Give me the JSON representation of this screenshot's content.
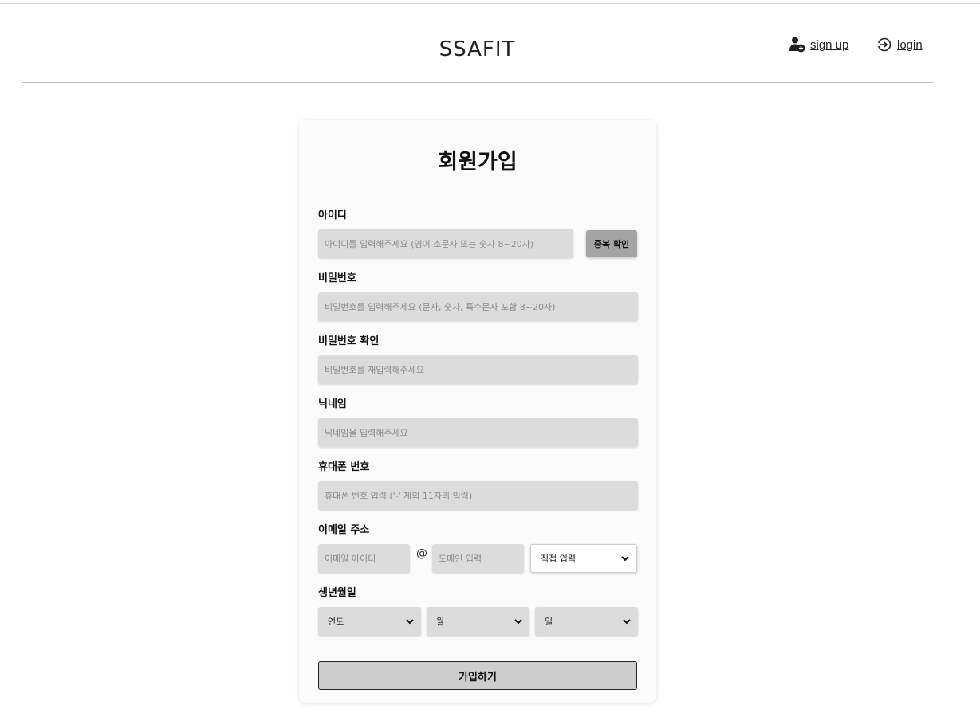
{
  "header": {
    "logo": "SSAFIT",
    "signup_label": "sign up",
    "login_label": "login"
  },
  "form": {
    "title": "회원가입",
    "id": {
      "label": "아이디",
      "placeholder": "아이디를 입력해주세요 (영어 소문자 또는 숫자 8~20자)",
      "check_button": "중복 확인"
    },
    "password": {
      "label": "비밀번호",
      "placeholder": "비밀번호를 입력해주세요 (문자, 숫자, 특수문자 포함 8~20자)"
    },
    "password_confirm": {
      "label": "비밀번호 확인",
      "placeholder": "비밀번호를 재입력해주세요"
    },
    "nickname": {
      "label": "닉네임",
      "placeholder": "닉네임을 입력해주세요"
    },
    "phone": {
      "label": "휴대폰 번호",
      "placeholder": "휴대폰 번호 입력 ('-' 제외 11자리 입력)"
    },
    "email": {
      "label": "이메일 주소",
      "id_placeholder": "이메일 아이디",
      "at": "@",
      "domain_placeholder": "도메인 입력",
      "domain_select": "직접 입력"
    },
    "birth": {
      "label": "생년월일",
      "year": "연도",
      "month": "월",
      "day": "일"
    },
    "submit_label": "가입하기"
  }
}
